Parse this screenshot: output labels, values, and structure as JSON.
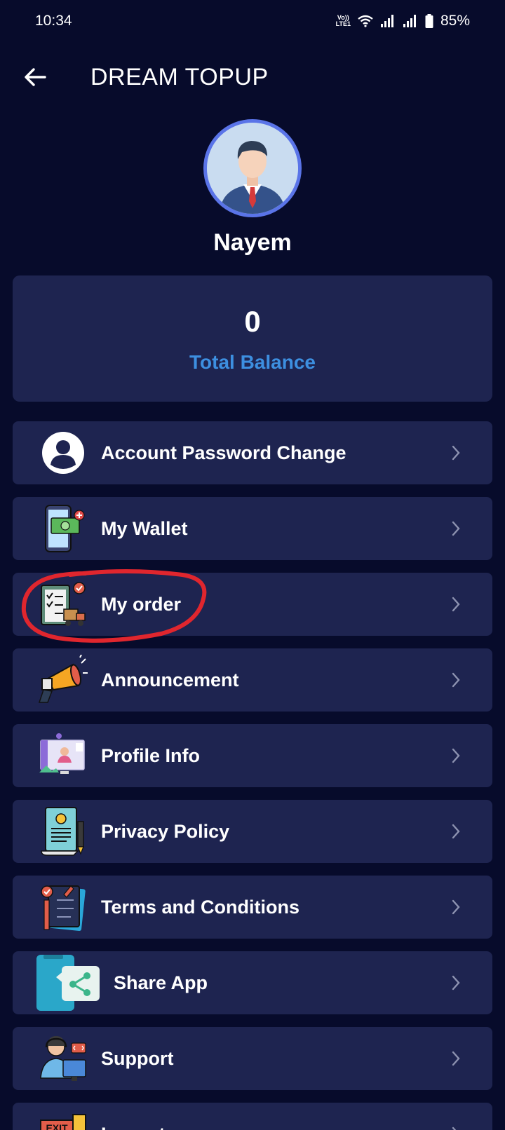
{
  "status_bar": {
    "time": "10:34",
    "network_label_top": "Vo))",
    "network_label_bottom": "LTE1",
    "battery": "85%"
  },
  "app_bar": {
    "title": "DREAM TOPUP",
    "back_icon": "arrow-left-icon"
  },
  "profile": {
    "name": "Nayem",
    "avatar_icon": "businessman-avatar"
  },
  "balance": {
    "value": "0",
    "label": "Total Balance",
    "label_color": "#3d8fe0"
  },
  "menu": {
    "items": [
      {
        "label": "Account Password Change",
        "icon": "user-circle-icon"
      },
      {
        "label": "My Wallet",
        "icon": "wallet-phone-icon"
      },
      {
        "label": "My order",
        "icon": "order-clipboard-icon"
      },
      {
        "label": "Announcement",
        "icon": "megaphone-icon"
      },
      {
        "label": "Profile Info",
        "icon": "profile-screen-icon"
      },
      {
        "label": "Privacy Policy",
        "icon": "policy-document-icon"
      },
      {
        "label": "Terms and Conditions",
        "icon": "terms-checklist-icon"
      },
      {
        "label": "Share App",
        "icon": "share-icon"
      },
      {
        "label": "Support",
        "icon": "support-agent-icon"
      },
      {
        "label": "Logout",
        "icon": "exit-door-icon"
      }
    ]
  },
  "annotation": {
    "highlight_color": "#e0262e",
    "highlighted_item": "My order"
  },
  "colors": {
    "background": "#070b2b",
    "card": "#1e2450",
    "accent": "#5a74e8"
  }
}
